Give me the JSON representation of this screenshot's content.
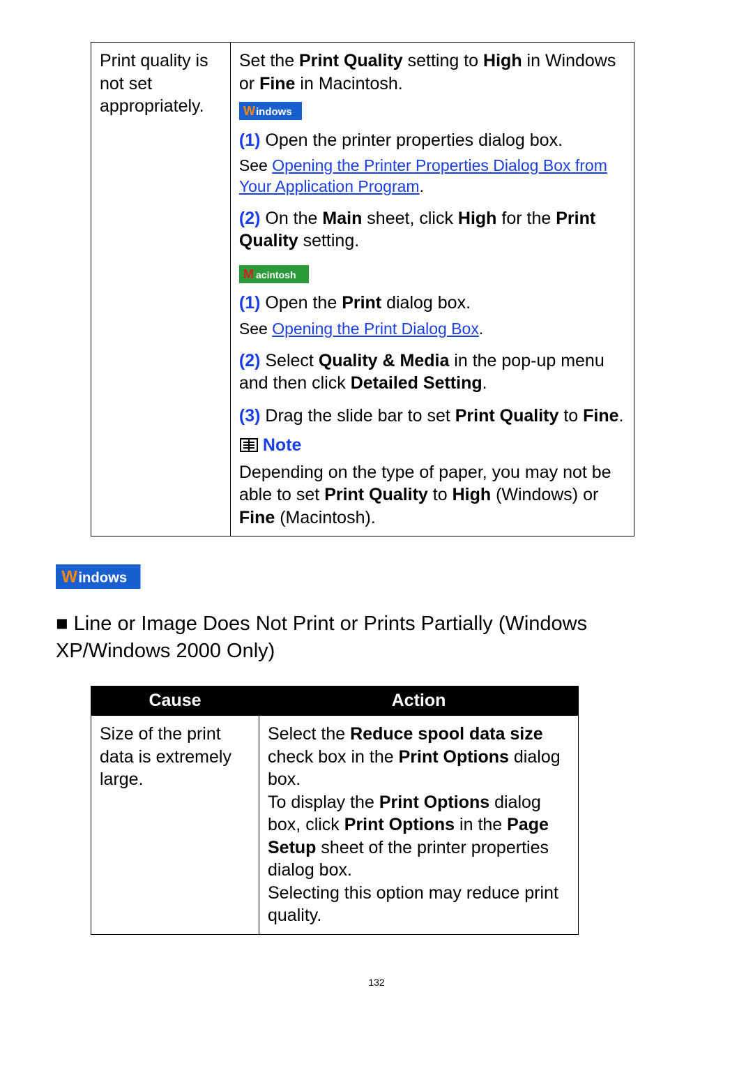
{
  "table1": {
    "cause": "Print quality is not set appropriately.",
    "action": {
      "intro_pre": "Set the ",
      "intro_pq": "Print Quality",
      "intro_mid": " setting to ",
      "intro_high": "High",
      "intro_mid2": " in Windows or ",
      "intro_fine": "Fine",
      "intro_end": " in Macintosh.",
      "win": {
        "s1_num": "(1)",
        "s1_text": " Open the printer properties dialog box.",
        "see_pre": "See ",
        "see_link": "Opening the Printer Properties Dialog Box from Your Application Program",
        "see_post": ".",
        "s2_num": "(2)",
        "s2_a": " On the ",
        "s2_b": "Main",
        "s2_c": " sheet, click ",
        "s2_d": "High",
        "s2_e": " for the ",
        "s2_f": "Print Quality",
        "s2_g": " setting."
      },
      "mac": {
        "s1_num": "(1)",
        "s1_a": " Open the ",
        "s1_b": "Print",
        "s1_c": " dialog box.",
        "see_pre": "See ",
        "see_link": "Opening the Print Dialog Box",
        "see_post": ".",
        "s2_num": "(2)",
        "s2_a": " Select ",
        "s2_b": "Quality & Media",
        "s2_c": " in the pop-up menu and then click ",
        "s2_d": "Detailed Setting",
        "s2_e": ".",
        "s3_num": "(3)",
        "s3_a": " Drag the slide bar to set ",
        "s3_b": "Print Quality",
        "s3_c": " to ",
        "s3_d": "Fine",
        "s3_e": "."
      },
      "note": {
        "label": "Note",
        "t1": "Depending on the type of paper, you may not be able to set ",
        "t2": "Print Quality",
        "t3": " to ",
        "t4": "High",
        "t5": " (Windows) or ",
        "t6": "Fine",
        "t7": " (Macintosh)."
      }
    }
  },
  "heading": {
    "bullet": "■",
    "text": " Line or Image Does Not Print or Prints Partially (Windows XP/Windows 2000 Only)"
  },
  "table2": {
    "head_cause": "Cause",
    "head_action": "Action",
    "cause": "Size of the print data is extremely large.",
    "action": {
      "a1": "Select the ",
      "a2": "Reduce spool data size",
      "a3": " check box in the ",
      "a4": "Print Options",
      "a5": " dialog box.",
      "b1": "To display the ",
      "b2": "Print Options",
      "b3": " dialog box, click ",
      "b4": "Print Options",
      "b5": " in the ",
      "b6": "Page Setup",
      "b7": " sheet of the printer properties dialog box.",
      "c1": "Selecting this option may reduce print quality."
    }
  },
  "page_number": "132"
}
